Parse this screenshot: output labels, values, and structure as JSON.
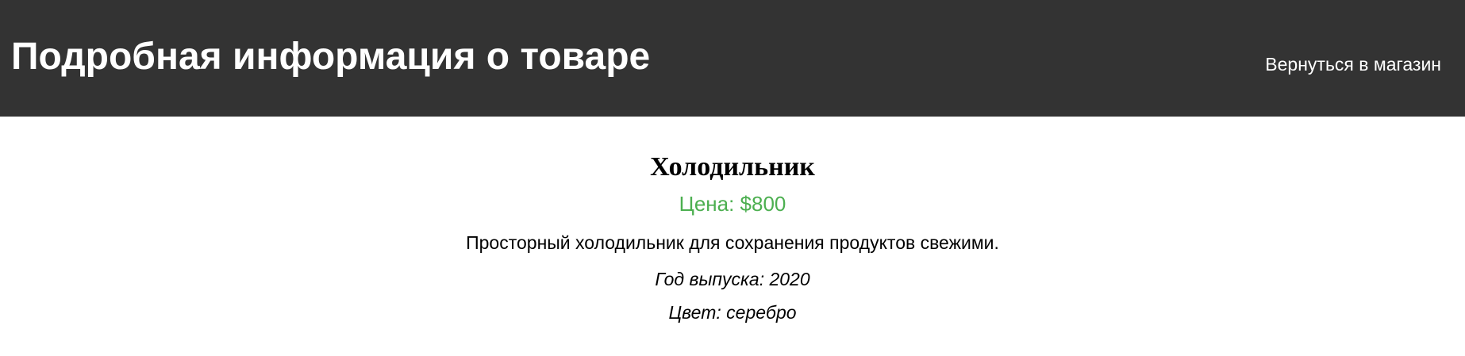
{
  "header": {
    "title": "Подробная информация о товаре",
    "back_link": "Вернуться в магазин",
    "background_color": "#333333"
  },
  "product": {
    "name": "Холодильник",
    "price": "Цена: $800",
    "price_color": "#4caf50",
    "description": "Просторный холодильник для сохранения продуктов свежими.",
    "year": "Год выпуска: 2020",
    "color": "Цвет: серебро"
  }
}
